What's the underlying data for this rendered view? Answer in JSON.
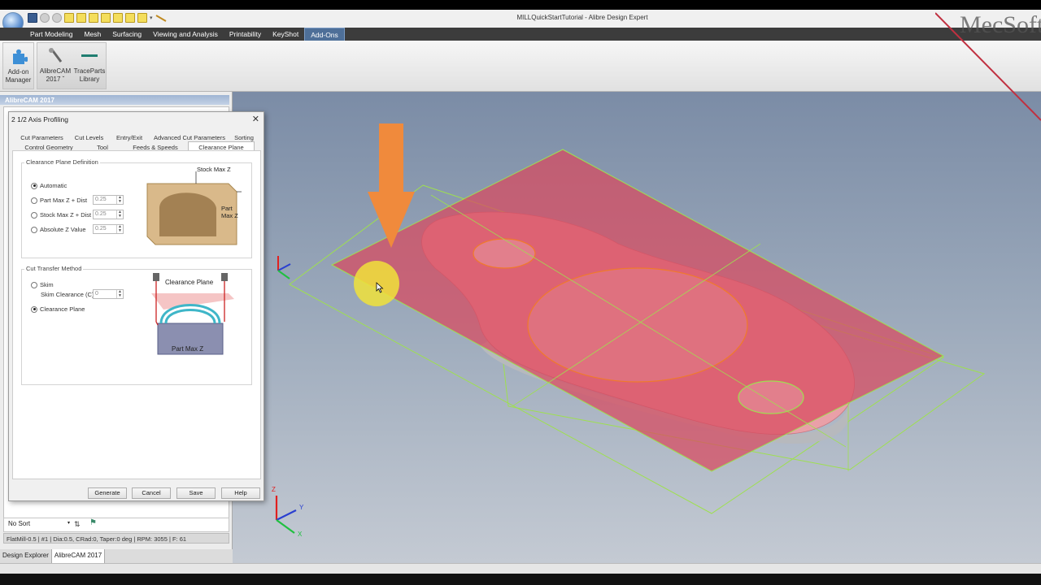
{
  "window": {
    "title": "MILLQuickStartTutorial - Alibre Design Expert"
  },
  "ribbon": {
    "tabs": [
      {
        "label": "Part Modeling"
      },
      {
        "label": "Mesh"
      },
      {
        "label": "Surfacing"
      },
      {
        "label": "Viewing and Analysis"
      },
      {
        "label": "Printability"
      },
      {
        "label": "KeyShot"
      },
      {
        "label": "Add-Ons",
        "active": true
      }
    ],
    "buttons": {
      "addon_manager": {
        "line1": "Add-on",
        "line2": "Manager"
      },
      "alibrecam": {
        "line1": "AlibreCAM",
        "line2": "2017 ˇ"
      },
      "traceparts": {
        "line1": "TraceParts",
        "line2": "Library"
      }
    }
  },
  "panel": {
    "title": "AlibreCAM 2017",
    "sort": "No Sort",
    "status": "FlatMill-0.5 | #1 | Dia:0.5, CRad:0, Taper:0 deg | RPM: 3055 | F: 61",
    "tabs": [
      {
        "label": "Design Explorer"
      },
      {
        "label": "AlibreCAM 2017",
        "active": true
      }
    ]
  },
  "dialog": {
    "title": "2 1/2 Axis Profiling",
    "close": "✕",
    "tabs_row1": [
      "Cut Parameters",
      "Cut Levels",
      "Entry/Exit",
      "Advanced Cut Parameters",
      "Sorting"
    ],
    "tabs_row2": [
      "Control Geometry",
      "Tool",
      "Feeds & Speeds",
      "Clearance Plane"
    ],
    "active_tab": "Clearance Plane",
    "clearance_plane_definition": {
      "label": "Clearance Plane Definition",
      "options": [
        {
          "label": "Automatic",
          "selected": true
        },
        {
          "label": "Part Max Z + Dist",
          "value": "0.25"
        },
        {
          "label": "Stock Max Z + Dist",
          "value": "0.25"
        },
        {
          "label": "Absolute Z Value",
          "value": "0.25"
        }
      ],
      "image_labels": {
        "stock": "Stock Max Z",
        "part": "Part Max Z"
      }
    },
    "cut_transfer_method": {
      "label": "Cut Transfer Method",
      "skim": "Skim",
      "skim_clearance_label": "Skim Clearance (C)",
      "skim_clearance_value": "0",
      "clearance_plane": "Clearance Plane",
      "selected": "Clearance Plane",
      "image_labels": {
        "top": "Clearance Plane",
        "bottom": "Part Max Z"
      }
    },
    "buttons": {
      "generate": "Generate",
      "cancel": "Cancel",
      "save": "Save",
      "help": "Help"
    }
  },
  "watermark": {
    "text": "MecSoft"
  },
  "colors": {
    "ribbon_tab_active": "#4e6f98",
    "clearance_plane": "#d84a5e",
    "wire": "#9ee04f",
    "arrow": "#f08a3c",
    "highlight": "#f0e23a",
    "toolpath": "#f07a2a"
  },
  "axes": {
    "x": "X",
    "y": "Y",
    "z": "Z"
  }
}
